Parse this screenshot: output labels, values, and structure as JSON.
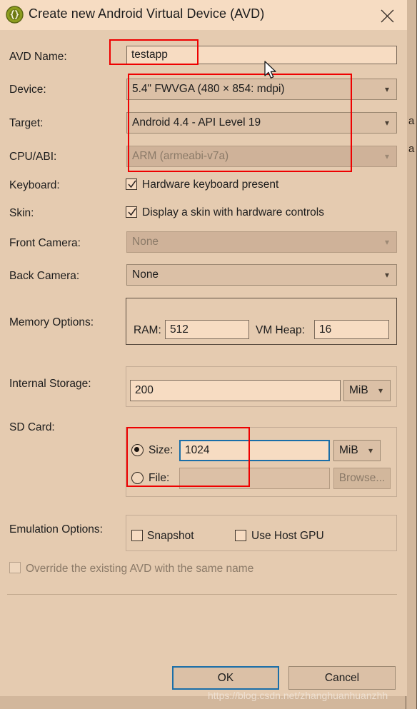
{
  "window": {
    "title": "Create new Android Virtual Device (AVD)",
    "icon": "android-sdk-braces-icon",
    "close_label": "✕"
  },
  "form": {
    "avd_name": {
      "label": "AVD Name:",
      "value": "testapp"
    },
    "device": {
      "label": "Device:",
      "value": "5.4\" FWVGA (480 × 854: mdpi)"
    },
    "target": {
      "label": "Target:",
      "value": "Android 4.4 - API Level 19"
    },
    "cpu_abi": {
      "label": "CPU/ABI:",
      "value": "ARM (armeabi-v7a)"
    },
    "keyboard": {
      "label": "Keyboard:",
      "checkbox_label": "Hardware keyboard present",
      "checked": true
    },
    "skin": {
      "label": "Skin:",
      "checkbox_label": "Display a skin with hardware controls",
      "checked": true
    },
    "front_camera": {
      "label": "Front Camera:",
      "value": "None"
    },
    "back_camera": {
      "label": "Back Camera:",
      "value": "None"
    },
    "memory_options": {
      "label": "Memory Options:",
      "ram_label": "RAM:",
      "ram_value": "512",
      "vm_heap_label": "VM Heap:",
      "vm_heap_value": "16"
    },
    "internal_storage": {
      "label": "Internal Storage:",
      "value": "200",
      "unit": "MiB"
    },
    "sd_card": {
      "label": "SD Card:",
      "size_radio_label": "Size:",
      "size_value": "1024",
      "size_unit": "MiB",
      "file_radio_label": "File:",
      "file_value": "",
      "browse_label": "Browse..."
    },
    "emulation_options": {
      "label": "Emulation Options:",
      "snapshot_label": "Snapshot",
      "snapshot_checked": false,
      "host_gpu_label": "Use Host GPU",
      "host_gpu_checked": false
    },
    "override": {
      "label": "Override the existing AVD with the same name",
      "checked": false,
      "disabled": true
    }
  },
  "footer": {
    "ok_label": "OK",
    "cancel_label": "Cancel"
  },
  "watermark": {
    "text": "https://blog.csdn.net/zhanghuanhuanzhh"
  },
  "background_window": {
    "fragment_1": "a",
    "fragment_2": "a"
  },
  "colors": {
    "dialog_bg": "#e5cbb0",
    "titlebar_bg": "#f6dcc2",
    "field_bg": "#f7dcc2",
    "combo_bg": "#dbc0a6",
    "disabled_bg": "#cfb299",
    "annotation_red": "#ee0000",
    "focus_blue": "#1a6ea8",
    "text": "#1c1c1c",
    "disabled_text": "#8b7a68"
  }
}
